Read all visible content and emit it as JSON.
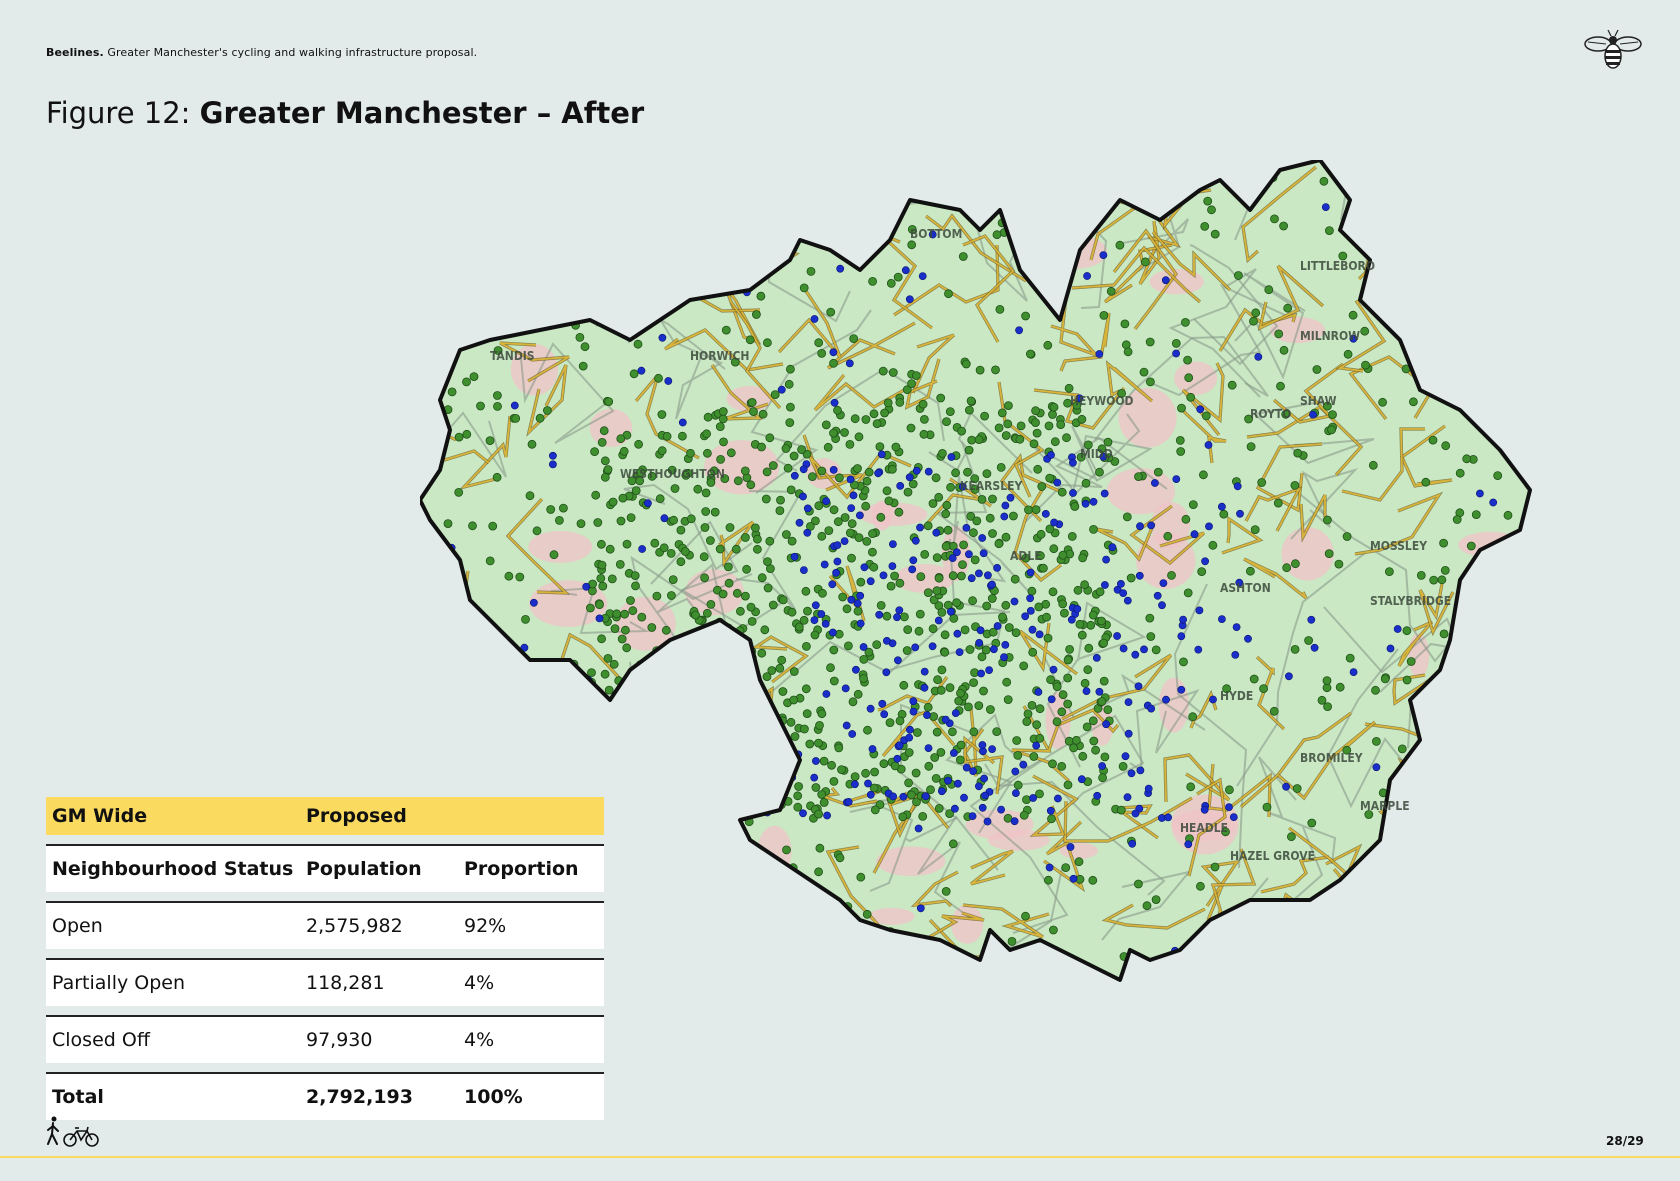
{
  "header": {
    "brand": "Beelines.",
    "subtitle": "Greater Manchester's cycling and walking infrastructure proposal."
  },
  "title": {
    "prefix": "Figure 12:",
    "main": "Greater Manchester – After"
  },
  "map": {
    "labels": [
      "BOTTOM",
      "HORWICH",
      "LITTLEBORO",
      "MILNROW",
      "HEYWOOD",
      "MIDD",
      "WESTHOUGHTON",
      "KEARSLEY",
      "ROYTO",
      "SHAW",
      "ASHTON",
      "MOSSLEY",
      "STALYBRIDGE",
      "HYDE",
      "BROMILEY",
      "MARPLE",
      "HEADLE",
      "HAZEL GROVE",
      "TANDIS",
      "ADLE"
    ],
    "legend_colors": {
      "boundary": "#111111",
      "land": "#c9e8c3",
      "urban": "#f0c4c8",
      "route": "#d9b43a",
      "open_dot": "#3f8f2e",
      "closed_dot": "#1a2fc9"
    }
  },
  "table": {
    "head": [
      "GM Wide",
      "Proposed",
      ""
    ],
    "columns": [
      "Neighbourhood Status",
      "Population",
      "Proportion"
    ],
    "rows": [
      [
        "Open",
        "2,575,982",
        "92%"
      ],
      [
        "Partially Open",
        "118,281",
        "4%"
      ],
      [
        "Closed Off",
        "97,930",
        "4%"
      ]
    ],
    "total": [
      "Total",
      "2,792,193",
      "100%"
    ]
  },
  "footer": {
    "page": "28/29",
    "icons": [
      "walking-person-icon",
      "bicycle-icon"
    ]
  }
}
